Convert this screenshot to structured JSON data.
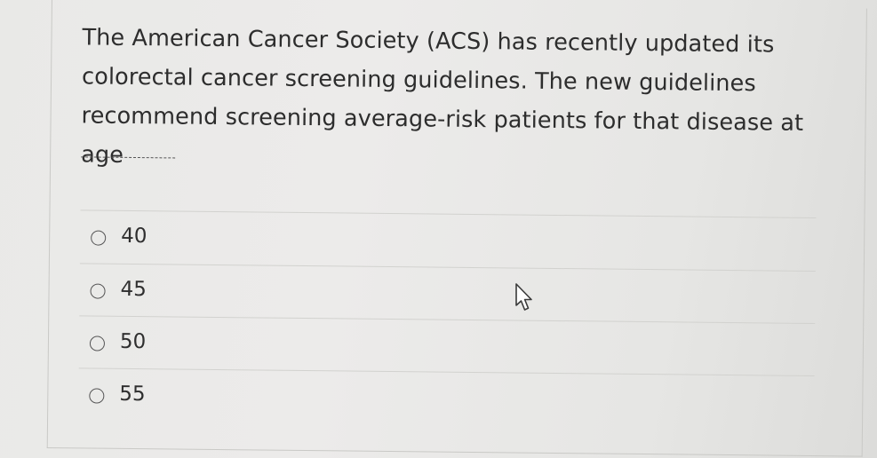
{
  "question": {
    "text": "The American Cancer Society (ACS) has recently updated its colorectal cancer screening guidelines. The new guidelines recommend screening average-risk patients for that disease at age",
    "blank": "--------"
  },
  "options": [
    {
      "label": "40"
    },
    {
      "label": "45"
    },
    {
      "label": "50"
    },
    {
      "label": "55"
    }
  ],
  "cursor": {
    "icon": "mouse-pointer-icon"
  }
}
